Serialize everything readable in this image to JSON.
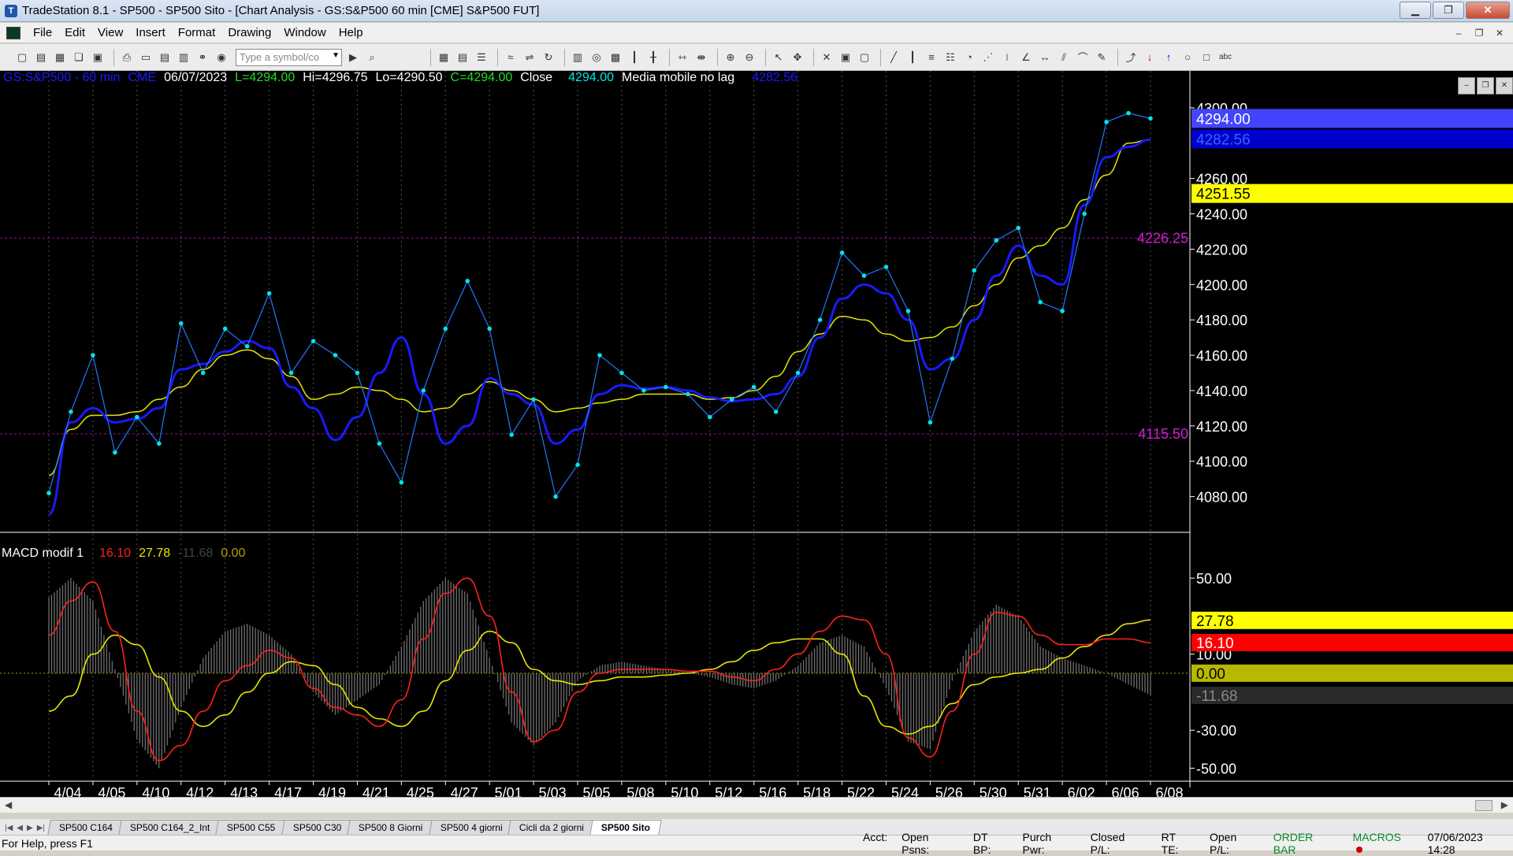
{
  "app": {
    "title": "TradeStation 8.1 - SP500 - SP500 Sito - [Chart Analysis - GS:S&P500  60 min  [CME] S&P500 FUT]",
    "icon": "tradestation-app-icon"
  },
  "window_buttons": {
    "minimize": "minimize-icon",
    "maximize": "maximize-icon",
    "close": "close-icon"
  },
  "menu": [
    "File",
    "Edit",
    "View",
    "Insert",
    "Format",
    "Drawing",
    "Window",
    "Help"
  ],
  "toolbar": {
    "symbol_placeholder": "Type a symbol/co",
    "icons": [
      "new-icon",
      "open-icon",
      "save-icon",
      "print-icon",
      "chart-icon",
      "zoom-in-icon",
      "zoom-out-icon",
      "cursor-icon",
      "trendline-icon",
      "arrow-up-icon",
      "arrow-down-icon",
      "ellipse-icon",
      "rectangle-icon",
      "text-icon"
    ]
  },
  "chart_header": {
    "symbol": "GS:S&P500 - 60 min",
    "exchange": "CME",
    "date": "06/07/2023",
    "low_label": "L=4294.00",
    "high_label": "Hi=4296.75",
    "lo_label": "Lo=4290.50",
    "close_label": "C=4294.00",
    "close_word": "Close",
    "close_value": "4294.00",
    "ma_name": "Media mobile no lag",
    "ma_value": "4282.56"
  },
  "macd_header": {
    "name": "MACD modif 1",
    "v1": "16.10",
    "v2": "27.78",
    "v3": "-11.68",
    "v4": "0.00"
  },
  "colors": {
    "background": "#000000",
    "price": "#00e6e6",
    "ma_blue": "#1a1aff",
    "ma_yellow": "#e6e600",
    "macd_red": "#ff2020",
    "hist": "#707070",
    "level_line": "#8b1a8b",
    "level_text": "#cc22cc",
    "grid": "#505050",
    "axis_text": "#ffffff"
  },
  "chart_data": [
    {
      "type": "line",
      "title": "GS:S&P500 - 60 min",
      "x_ticks": [
        "4/04",
        "4/05",
        "4/10",
        "4/12",
        "4/13",
        "4/17",
        "4/19",
        "4/21",
        "4/25",
        "4/27",
        "5/01",
        "5/03",
        "5/05",
        "5/08",
        "5/10",
        "5/12",
        "5/16",
        "5/18",
        "5/22",
        "5/24",
        "5/26",
        "5/30",
        "5/31",
        "6/02",
        "6/06",
        "6/08"
      ],
      "y_ticks": [
        "4300.00",
        "4260.00",
        "4240.00",
        "4220.00",
        "4200.00",
        "4180.00",
        "4160.00",
        "4140.00",
        "4120.00",
        "4100.00",
        "4080.00"
      ],
      "ylim": [
        4066,
        4312
      ],
      "x": [
        0,
        0.5,
        1,
        1.5,
        2,
        2.5,
        3,
        3.5,
        4,
        4.5,
        5,
        5.5,
        6,
        6.5,
        7,
        7.5,
        8,
        8.5,
        9,
        9.5,
        10,
        10.5,
        11,
        11.5,
        12,
        12.5,
        13,
        13.5,
        14,
        14.5,
        15,
        15.5,
        16,
        16.5,
        17,
        17.5,
        18,
        18.5,
        19,
        19.5,
        20,
        20.5,
        21,
        21.5,
        22,
        22.5,
        23,
        23.5,
        24,
        24.5,
        25
      ],
      "series": [
        {
          "name": "Close",
          "values": [
            4082,
            4128,
            4160,
            4105,
            4125,
            4110,
            4178,
            4150,
            4175,
            4165,
            4195,
            4150,
            4168,
            4160,
            4150,
            4110,
            4088,
            4140,
            4175,
            4202,
            4175,
            4115,
            4135,
            4080,
            4098,
            4160,
            4150,
            4140,
            4142,
            4138,
            4125,
            4135,
            4142,
            4128,
            4150,
            4180,
            4218,
            4205,
            4210,
            4185,
            4122,
            4158,
            4208,
            4225,
            4232,
            4190,
            4185,
            4240,
            4292,
            4297,
            4294
          ]
        },
        {
          "name": "Media mobile no lag",
          "values": [
            4070,
            4122,
            4130,
            4122,
            4124,
            4130,
            4152,
            4155,
            4162,
            4168,
            4164,
            4142,
            4130,
            4112,
            4125,
            4150,
            4170,
            4138,
            4110,
            4120,
            4147,
            4138,
            4132,
            4110,
            4118,
            4138,
            4143,
            4141,
            4142,
            4140,
            4136,
            4134,
            4135,
            4138,
            4148,
            4170,
            4192,
            4200,
            4195,
            4180,
            4152,
            4158,
            4180,
            4205,
            4222,
            4205,
            4200,
            4245,
            4272,
            4278,
            4282
          ]
        },
        {
          "name": "yellow-average",
          "values": [
            4092,
            4118,
            4126,
            4126,
            4128,
            4135,
            4142,
            4152,
            4160,
            4163,
            4158,
            4148,
            4135,
            4138,
            4142,
            4140,
            4135,
            4128,
            4130,
            4138,
            4145,
            4140,
            4135,
            4128,
            4130,
            4133,
            4135,
            4138,
            4138,
            4138,
            4135,
            4136,
            4140,
            4148,
            4162,
            4172,
            4182,
            4180,
            4172,
            4168,
            4170,
            4176,
            4188,
            4200,
            4215,
            4222,
            4232,
            4248,
            4262,
            4280,
            4282
          ]
        }
      ],
      "levels": [
        {
          "label": "4226.25",
          "value": 4226.25
        },
        {
          "label": "4115.50",
          "value": 4115.5
        }
      ],
      "price_tags": [
        {
          "label": "4294.00",
          "value": 4294
        },
        {
          "label": "4282.56",
          "value": 4282.56
        },
        {
          "label": "4251.55",
          "value": 4251.55
        }
      ]
    },
    {
      "type": "line",
      "title": "MACD modif 1",
      "y_ticks": [
        "50.00",
        "10.00",
        "-30.00",
        "-50.00"
      ],
      "ylim": [
        -56,
        60
      ],
      "x": [
        0,
        0.5,
        1,
        1.5,
        2,
        2.5,
        3,
        3.5,
        4,
        4.5,
        5,
        5.5,
        6,
        6.5,
        7,
        7.5,
        8,
        8.5,
        9,
        9.5,
        10,
        10.5,
        11,
        11.5,
        12,
        12.5,
        13,
        13.5,
        14,
        14.5,
        15,
        15.5,
        16,
        16.5,
        17,
        17.5,
        18,
        18.5,
        19,
        19.5,
        20,
        20.5,
        21,
        21.5,
        22,
        22.5,
        23,
        23.5,
        24,
        24.5,
        25
      ],
      "series": [
        {
          "name": "red",
          "values": [
            20,
            38,
            48,
            22,
            -20,
            -46,
            -38,
            -20,
            -4,
            4,
            12,
            8,
            -8,
            -18,
            -22,
            -28,
            -14,
            18,
            42,
            50,
            30,
            -10,
            -36,
            -30,
            -10,
            0,
            2,
            2,
            2,
            1,
            1,
            -2,
            -4,
            2,
            10,
            22,
            30,
            28,
            10,
            -34,
            -44,
            -20,
            10,
            32,
            30,
            20,
            15,
            15,
            18,
            18,
            16
          ]
        },
        {
          "name": "yellow",
          "values": [
            -20,
            -12,
            10,
            20,
            15,
            -2,
            -20,
            -28,
            -22,
            -10,
            0,
            6,
            4,
            -6,
            -18,
            -24,
            -28,
            -20,
            -4,
            12,
            22,
            16,
            2,
            -4,
            -6,
            -4,
            -2,
            -2,
            -1,
            0,
            2,
            6,
            12,
            16,
            18,
            18,
            10,
            -12,
            -28,
            -32,
            -28,
            -16,
            -6,
            -2,
            0,
            2,
            8,
            14,
            20,
            26,
            28
          ]
        },
        {
          "name": "histogram",
          "values": [
            40,
            50,
            38,
            2,
            -35,
            -50,
            -18,
            8,
            22,
            26,
            20,
            10,
            -10,
            -22,
            -14,
            -6,
            14,
            38,
            50,
            42,
            8,
            -26,
            -38,
            -26,
            -4,
            4,
            6,
            4,
            2,
            0,
            -2,
            -6,
            -8,
            -4,
            4,
            16,
            20,
            14,
            -8,
            -36,
            -40,
            -4,
            22,
            36,
            30,
            14,
            8,
            4,
            0,
            -6,
            -11.68
          ]
        }
      ],
      "zero_label": "0.00",
      "value_tags": [
        {
          "label": "27.78",
          "value": 27.78
        },
        {
          "label": "16.10",
          "value": 16.1
        },
        {
          "label": "0.00",
          "value": 0
        },
        {
          "label": "-11.68",
          "value": -11.68
        }
      ]
    }
  ],
  "tabs": [
    "SP500 C164",
    "SP500 C164_2_Int",
    "SP500 C55",
    "SP500 C30",
    "SP500 8 Giorni",
    "SP500 4 giorni",
    "Cicli da 2 giorni",
    "SP500 Sito"
  ],
  "active_tab": "SP500 Sito",
  "status": {
    "help": "For Help, press F1",
    "fields": [
      "Acct:",
      "Open Psns:",
      "DT BP:",
      "Purch Pwr:",
      "Closed P/L:",
      "RT TE:",
      "Open P/L:"
    ],
    "order_bar": "ORDER BAR",
    "macros": "MACROS",
    "datetime": "07/06/2023 14:28"
  }
}
